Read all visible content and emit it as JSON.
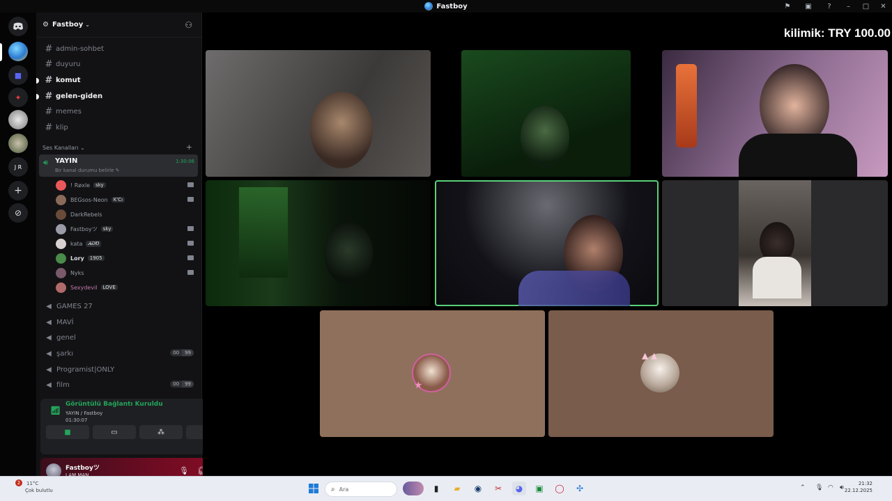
{
  "window": {
    "title": "Fastboy"
  },
  "guild": {
    "name": "Fastboy"
  },
  "text_channels": [
    {
      "name": "admin-sohbet",
      "bold": false
    },
    {
      "name": "duyuru",
      "bold": false
    },
    {
      "name": "komut",
      "bold": true
    },
    {
      "name": "gelen-giden",
      "bold": true
    },
    {
      "name": "memes",
      "bold": false
    },
    {
      "name": "klip",
      "bold": false
    }
  ],
  "voice_category": "Ses Kanalları",
  "active_voice": {
    "name": "YAYIN",
    "status": "Bir kanal durumu belirle",
    "timer": "1:30:06"
  },
  "voice_users": [
    {
      "name": "! Røxle",
      "tag": "sky",
      "color": "#e8585a"
    },
    {
      "name": "BEGsos-Neon",
      "tag": "K'Cı",
      "color": "#8a6a5a"
    },
    {
      "name": "DarkRebels",
      "tag": "",
      "color": "#6a4a3a"
    },
    {
      "name": "Fastboyツ",
      "tag": "sky",
      "color": "#9a9aa8"
    },
    {
      "name": "kata",
      "tag": "ᏗᏍᏬ",
      "color": "#d8d0d0"
    },
    {
      "name": "Lory",
      "tag": "1905",
      "color": "#4a8a4a"
    },
    {
      "name": "Nyks",
      "tag": "",
      "color": "#7a5a6a"
    },
    {
      "name": "Sexydevil",
      "tag": "LOVE",
      "color": "#b06a6a"
    }
  ],
  "voice_channels": [
    {
      "name": "GAMES 27",
      "counts": []
    },
    {
      "name": "MAVİ",
      "counts": []
    },
    {
      "name": "genel",
      "counts": []
    },
    {
      "name": "şarkı",
      "counts": [
        "00",
        "99"
      ]
    },
    {
      "name": "Programist|ONLY",
      "counts": []
    },
    {
      "name": "film",
      "counts": [
        "00",
        "99"
      ]
    }
  ],
  "rtc": {
    "title": "Görüntülü Bağlantı Kuruldu",
    "channel": "YAYIN / Fastboy",
    "time": "01:30:07"
  },
  "user": {
    "name": "Fastboyツ",
    "status": "I AM MAN"
  },
  "stream_overlay": "kilimik: TRY 100.00",
  "tiles": [
    {
      "label": "",
      "bg": "#4a4644"
    },
    {
      "label": "",
      "bg": "#102a12"
    },
    {
      "label": "",
      "bg": "#2a1a2e"
    },
    {
      "label": "",
      "bg": "#0a2a0a"
    },
    {
      "label": "",
      "bg": "#1a1a20"
    },
    {
      "label": "",
      "bg": "#2a2a2c"
    },
    {
      "label": "",
      "bg": "#8f705c"
    },
    {
      "label": "",
      "bg": "#7a5c4c"
    }
  ],
  "taskbar": {
    "weather_badge": "2",
    "weather_temp": "11°C",
    "weather_desc": "Çok bulutlu",
    "search_placeholder": "Ara",
    "time": "21:32",
    "date": "22.12.2025"
  },
  "icons": {
    "discord": "discord-icon",
    "add_server": "plus-icon",
    "explore": "compass-icon"
  }
}
